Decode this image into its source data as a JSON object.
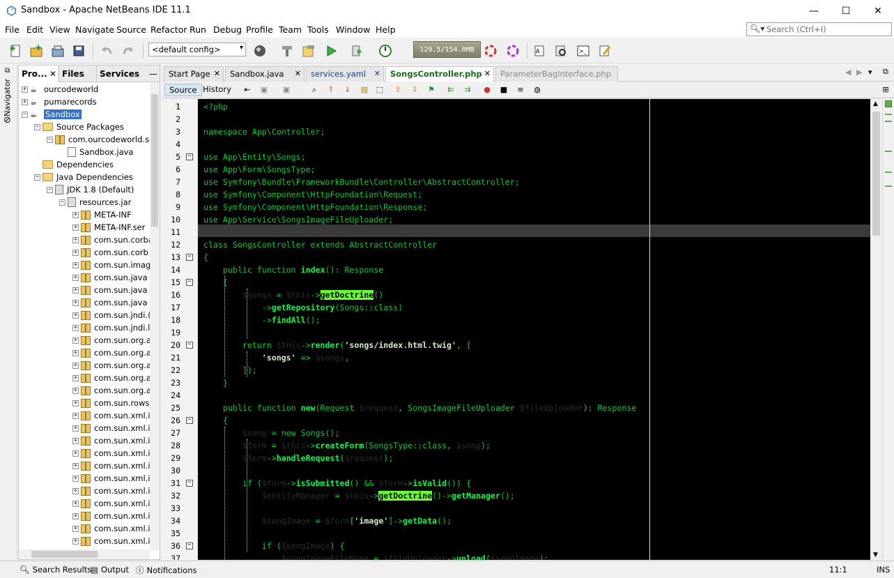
{
  "window": {
    "title": "Sandbox - Apache NetBeans IDE 11.1",
    "minimize_icon": "—",
    "maximize_icon": "☐",
    "close_icon": "✕"
  },
  "menu": [
    "File",
    "Edit",
    "View",
    "Navigate",
    "Source",
    "Refactor",
    "Run",
    "Debug",
    "Profile",
    "Team",
    "Tools",
    "Window",
    "Help"
  ],
  "search": {
    "placeholder": "Search (Ctrl+I)"
  },
  "toolbar": {
    "config": "<default config>",
    "memory": "129.5/154.0MB"
  },
  "navigator": {
    "label": "Navigator"
  },
  "projects_panel": {
    "tabs": [
      "Pro...",
      "Files",
      "Services"
    ],
    "tree": [
      {
        "label": "ourcodeworld",
        "depth": 0,
        "toggle": "+",
        "icon": "cup"
      },
      {
        "label": "pumarecords",
        "depth": 0,
        "toggle": "+",
        "icon": "cup"
      },
      {
        "label": "Sandbox",
        "depth": 0,
        "toggle": "−",
        "icon": "cup",
        "selected": true
      },
      {
        "label": "Source Packages",
        "depth": 1,
        "toggle": "−",
        "icon": "folder"
      },
      {
        "label": "com.ourcodeworld.san",
        "depth": 2,
        "toggle": "−",
        "icon": "pkg"
      },
      {
        "label": "Sandbox.java",
        "depth": 3,
        "toggle": "",
        "icon": "file"
      },
      {
        "label": "Dependencies",
        "depth": 1,
        "toggle": "",
        "icon": "folder"
      },
      {
        "label": "Java Dependencies",
        "depth": 1,
        "toggle": "−",
        "icon": "folder"
      },
      {
        "label": "JDK 1.8 (Default)",
        "depth": 2,
        "toggle": "−",
        "icon": "jar"
      },
      {
        "label": "resources.jar",
        "depth": 3,
        "toggle": "−",
        "icon": "jar"
      },
      {
        "label": "META-INF",
        "depth": 4,
        "toggle": "+",
        "icon": "pkg"
      },
      {
        "label": "META-INF.ser",
        "depth": 4,
        "toggle": "+",
        "icon": "pkg"
      },
      {
        "label": "com.sun.corba",
        "depth": 4,
        "toggle": "+",
        "icon": "pkg"
      },
      {
        "label": "com.sun.corb",
        "depth": 4,
        "toggle": "+",
        "icon": "pkg"
      },
      {
        "label": "com.sun.imag",
        "depth": 4,
        "toggle": "+",
        "icon": "pkg"
      },
      {
        "label": "com.sun.java",
        "depth": 4,
        "toggle": "+",
        "icon": "pkg"
      },
      {
        "label": "com.sun.java",
        "depth": 4,
        "toggle": "+",
        "icon": "pkg"
      },
      {
        "label": "com.sun.java",
        "depth": 4,
        "toggle": "+",
        "icon": "pkg"
      },
      {
        "label": "com.sun.jndi.(",
        "depth": 4,
        "toggle": "+",
        "icon": "pkg"
      },
      {
        "label": "com.sun.jndi.l",
        "depth": 4,
        "toggle": "+",
        "icon": "pkg"
      },
      {
        "label": "com.sun.org.a",
        "depth": 4,
        "toggle": "+",
        "icon": "pkg"
      },
      {
        "label": "com.sun.org.a",
        "depth": 4,
        "toggle": "+",
        "icon": "pkg"
      },
      {
        "label": "com.sun.org.a",
        "depth": 4,
        "toggle": "+",
        "icon": "pkg"
      },
      {
        "label": "com.sun.org.a",
        "depth": 4,
        "toggle": "+",
        "icon": "pkg"
      },
      {
        "label": "com.sun.org.a",
        "depth": 4,
        "toggle": "+",
        "icon": "pkg"
      },
      {
        "label": "com.sun.rows",
        "depth": 4,
        "toggle": "+",
        "icon": "pkg"
      },
      {
        "label": "com.sun.xml.i",
        "depth": 4,
        "toggle": "+",
        "icon": "pkg"
      },
      {
        "label": "com.sun.xml.i",
        "depth": 4,
        "toggle": "+",
        "icon": "pkg"
      },
      {
        "label": "com.sun.xml.i",
        "depth": 4,
        "toggle": "+",
        "icon": "pkg"
      },
      {
        "label": "com.sun.xml.i",
        "depth": 4,
        "toggle": "+",
        "icon": "pkg"
      },
      {
        "label": "com.sun.xml.i",
        "depth": 4,
        "toggle": "+",
        "icon": "pkg"
      },
      {
        "label": "com.sun.xml.i",
        "depth": 4,
        "toggle": "+",
        "icon": "pkg"
      },
      {
        "label": "com.sun.xml.i",
        "depth": 4,
        "toggle": "+",
        "icon": "pkg"
      },
      {
        "label": "com.sun.xml.i",
        "depth": 4,
        "toggle": "+",
        "icon": "pkg"
      },
      {
        "label": "com.sun.xml.i",
        "depth": 4,
        "toggle": "+",
        "icon": "pkg"
      },
      {
        "label": "com.sun.xml.i",
        "depth": 4,
        "toggle": "+",
        "icon": "pkg"
      },
      {
        "label": "com.sun.xml.i",
        "depth": 4,
        "toggle": "+",
        "icon": "pkg"
      }
    ]
  },
  "editor": {
    "tabs": [
      {
        "label": "Start Page",
        "active": false
      },
      {
        "label": "Sandbox.java",
        "active": false
      },
      {
        "label": "services.yaml",
        "active": false
      },
      {
        "label": "SongsController.php",
        "active": true
      },
      {
        "label": "ParameterBagInterface.php",
        "active": false
      }
    ],
    "source_button": "Source",
    "history_button": "History",
    "code_lines": [
      "<?php",
      "",
      "namespace App\\Controller;",
      "",
      "use App\\Entity\\Songs;",
      "use App\\Form\\SongsType;",
      "use Symfony\\Bundle\\FrameworkBundle\\Controller\\AbstractController;",
      "use Symfony\\Component\\HttpFoundation\\Request;",
      "use Symfony\\Component\\HttpFoundation\\Response;",
      "use App\\Service\\SongsImageFileUploader;",
      "",
      "class SongsController extends AbstractController",
      "{",
      "    public function index(): Response",
      "    {",
      "        $songs = $this->getDoctrine()",
      "            ->getRepository(Songs::class)",
      "            ->findAll();",
      "",
      "        return $this->render('songs/index.html.twig', [",
      "            'songs' => $songs,",
      "        ]);",
      "    }",
      "",
      "    public function new(Request $request, SongsImageFileUploader $fileUploader): Response",
      "    {",
      "        $song = new Songs();",
      "        $form = $this->createForm(SongsType::class, $song);",
      "        $form->handleRequest($request);",
      "",
      "        if ($form->isSubmitted() && $form->isValid()) {",
      "            $entityManager = $this->getDoctrine()->getManager();",
      "",
      "            $songImage = $form['image']->getData();",
      "",
      "            if ($songImage) {",
      "                $songImageFileName = $fileUploader->upload($songImage);"
    ],
    "fold_lines": [
      5,
      13,
      15,
      20,
      26,
      31,
      36
    ]
  },
  "statusbar": {
    "search_results": "Search Results",
    "output": "Output",
    "notifications": "Notifications",
    "position": "11:1",
    "mode": "INS"
  }
}
